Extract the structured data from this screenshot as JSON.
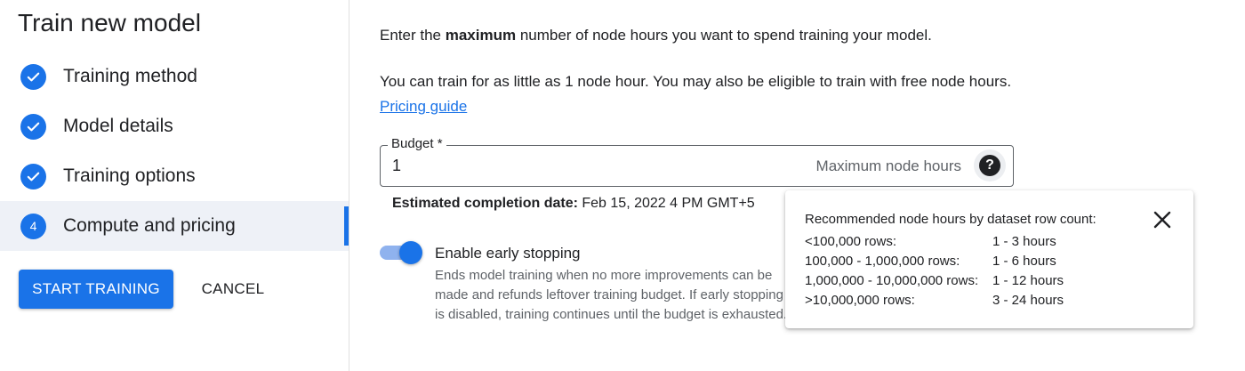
{
  "sidebar": {
    "title": "Train new model",
    "steps": [
      {
        "label": "Training method",
        "state": "done"
      },
      {
        "label": "Model details",
        "state": "done"
      },
      {
        "label": "Training options",
        "state": "done"
      },
      {
        "label": "Compute and pricing",
        "state": "active",
        "number": "4"
      }
    ],
    "start_label": "START TRAINING",
    "cancel_label": "CANCEL"
  },
  "main": {
    "intro_prefix": "Enter the ",
    "intro_bold": "maximum",
    "intro_suffix": " number of node hours you want to spend training your model.",
    "info_text": "You can train for as little as 1 node hour. You may also be eligible to train with free node hours.",
    "pricing_link": "Pricing guide",
    "budget": {
      "label": "Budget *",
      "value": "1",
      "hint": "Maximum node hours",
      "help_icon": "?"
    },
    "estimated": {
      "label": "Estimated completion date:",
      "value": "Feb 15, 2022 4 PM GMT+5"
    },
    "early_stopping": {
      "label": "Enable early stopping",
      "enabled": true,
      "desc": "Ends model training when no more improvements can be made and refunds leftover training budget. If early stopping is disabled, training continues until the budget is exhausted."
    }
  },
  "popup": {
    "title": "Recommended node hours by dataset row count:",
    "rows": [
      {
        "rows": "<100,000 rows:",
        "hours": "1 - 3 hours"
      },
      {
        "rows": "100,000 - 1,000,000 rows:",
        "hours": "1 - 6 hours"
      },
      {
        "rows": "1,000,000 - 10,000,000 rows:",
        "hours": "1 - 12 hours"
      },
      {
        "rows": ">10,000,000 rows:",
        "hours": "3 - 24 hours"
      }
    ]
  },
  "colors": {
    "accent": "#1a73e8",
    "active_step_bg": "#eef1f7"
  },
  "icons": {
    "step_done": "check-icon",
    "help": "help-icon",
    "close": "close-icon"
  }
}
